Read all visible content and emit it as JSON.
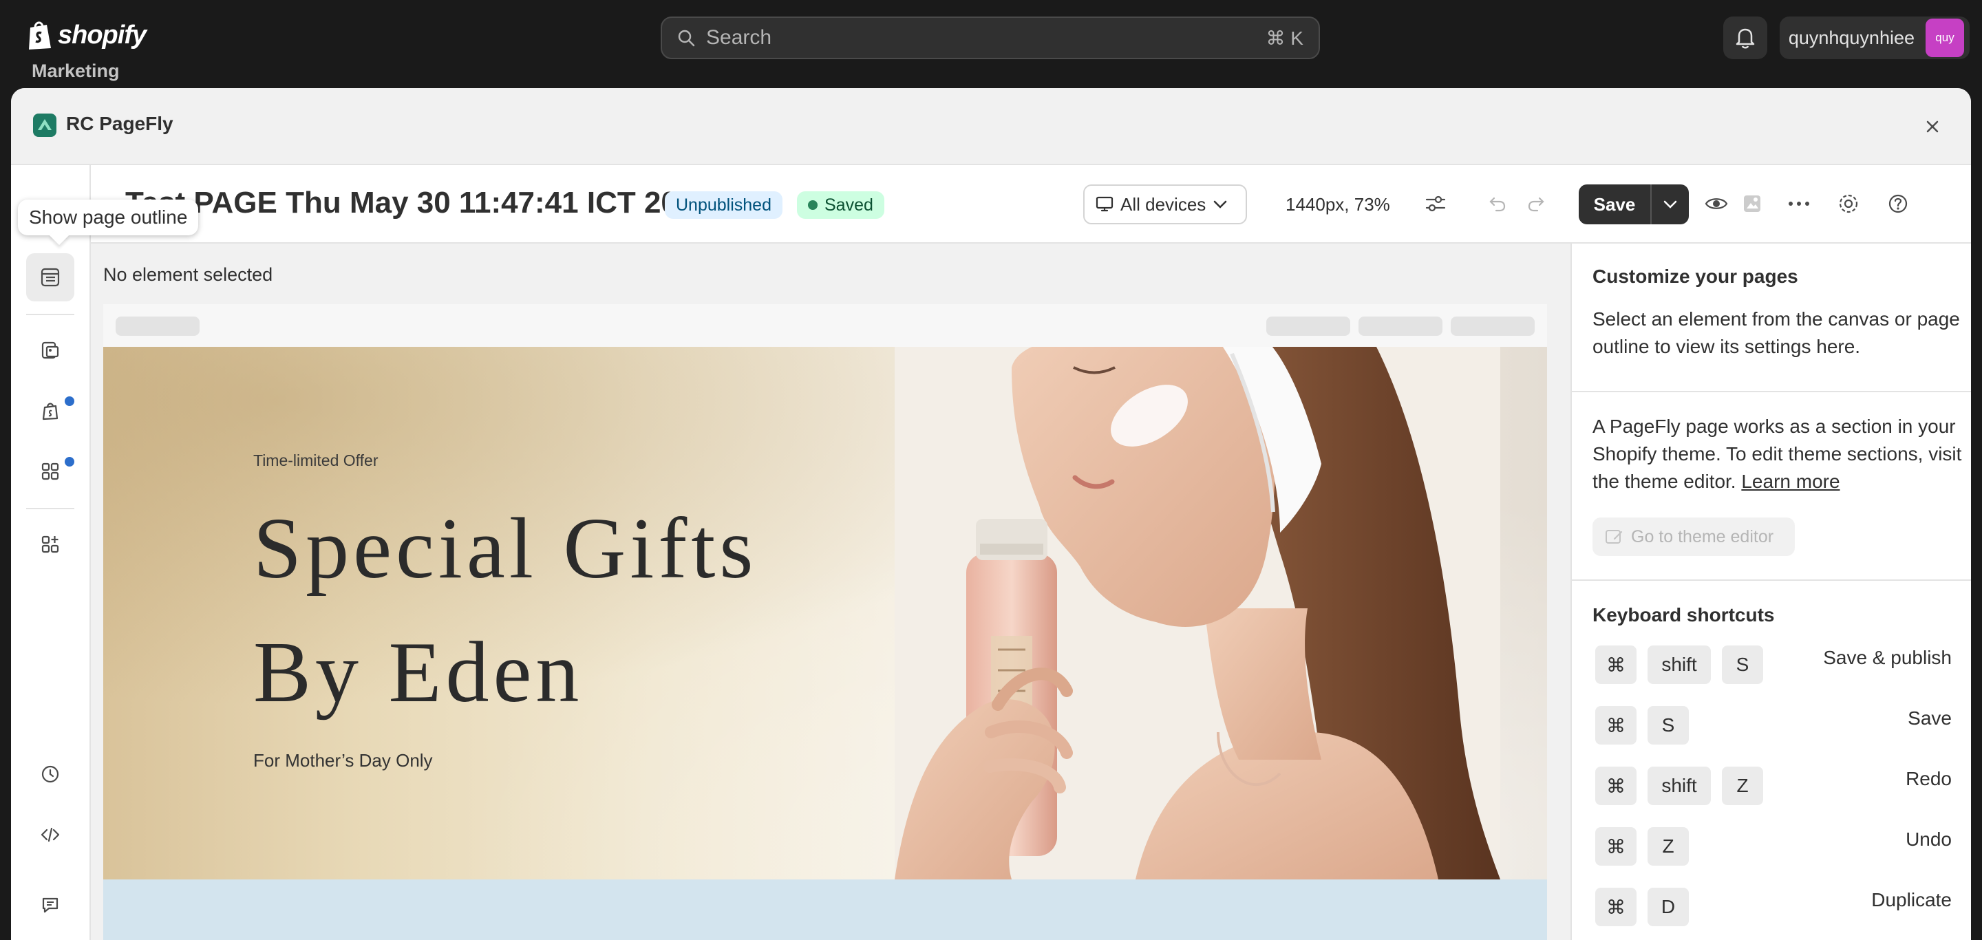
{
  "shopify": {
    "brand": "shopify",
    "search_placeholder": "Search",
    "search_shortcut": "⌘ K",
    "user_name": "quynhquynhiee",
    "avatar_initials": "quy",
    "background_nav_item": "Marketing"
  },
  "modal": {
    "app_name": "RC PageFly",
    "close_icon": "close-icon"
  },
  "rail": {
    "tooltip": "Show page outline",
    "items": [
      "page-outline-icon",
      "page-layout-icon",
      "shopify-bag-icon",
      "apps-grid-icon",
      "add-apps-icon",
      "history-icon",
      "code-icon",
      "chat-icon"
    ]
  },
  "toolbar": {
    "page_title": "Test PAGE Thu May 30 11:47:41 ICT 2024",
    "status_unpublished": "Unpublished",
    "status_saved": "Saved",
    "device_select": "All devices",
    "viewport": "1440px, 73%",
    "save_label": "Save"
  },
  "canvas": {
    "selection_status": "No element selected",
    "hero": {
      "eyebrow": "Time-limited Offer",
      "title_line1": "Special Gifts",
      "title_line2": "By Eden",
      "footnote": "For Mother’s Day Only"
    }
  },
  "panel": {
    "customize_heading": "Customize your pages",
    "customize_text": "Select an element from the canvas or page outline to view its settings here.",
    "section_text": "A PageFly page works as a section in your Shopify theme. To edit theme sections, visit the theme editor.",
    "learn_more": "Learn more",
    "theme_editor_button": "Go to theme editor",
    "shortcuts_heading": "Keyboard shortcuts",
    "shortcuts": [
      {
        "keys": [
          "⌘",
          "shift",
          "S"
        ],
        "label": "Save & publish"
      },
      {
        "keys": [
          "⌘",
          "S"
        ],
        "label": "Save"
      },
      {
        "keys": [
          "⌘",
          "shift",
          "Z"
        ],
        "label": "Redo"
      },
      {
        "keys": [
          "⌘",
          "Z"
        ],
        "label": "Undo"
      },
      {
        "keys": [
          "⌘",
          "D"
        ],
        "label": "Duplicate"
      }
    ]
  },
  "colors": {
    "topbar": "#1a1a1a",
    "primary_button": "#303030",
    "unpublished_badge": "#e0f0ff",
    "saved_badge": "#cdfee1",
    "notification_dot": "#2c6ecb",
    "avatar": "#c640c4"
  }
}
